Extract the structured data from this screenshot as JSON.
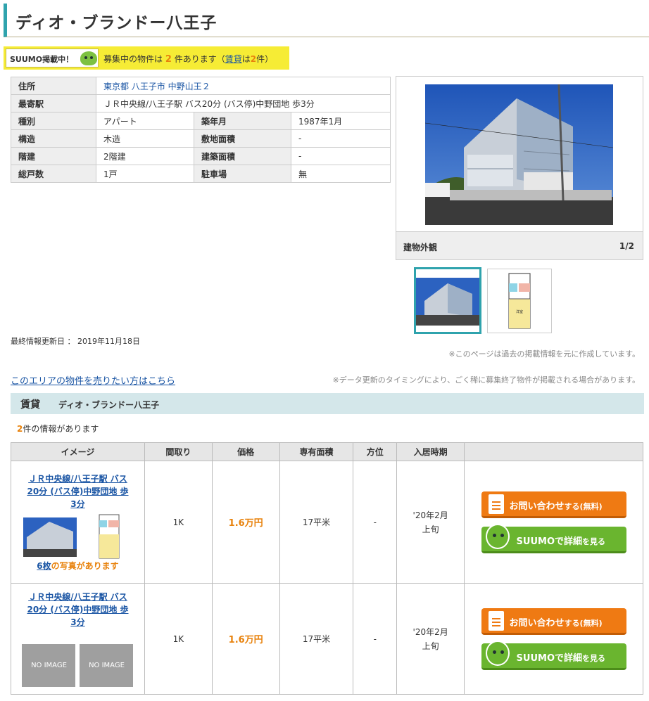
{
  "page": {
    "title": "ディオ・ブランドー八王子"
  },
  "suumo": {
    "tag": "SUUMO掲載中！",
    "msg_prefix": "募集中の物件は",
    "count": "2",
    "msg_mid": "件あります（",
    "rent_link": "賃貸",
    "msg_wa": "は",
    "rent_count": "2",
    "msg_suffix": "件）"
  },
  "info": {
    "address_label": "住所",
    "address_value": "東京都 八王子市 中野山王２",
    "station_label": "最寄駅",
    "station_value": "ＪＲ中央線/八王子駅 バス20分 (バス停)中野団地 歩3分",
    "type_label": "種別",
    "type_value": "アパート",
    "built_label": "築年月",
    "built_value": "1987年1月",
    "structure_label": "構造",
    "structure_value": "木造",
    "site_area_label": "敷地面積",
    "site_area_value": "-",
    "floors_label": "階建",
    "floors_value": "2階建",
    "building_area_label": "建築面積",
    "building_area_value": "-",
    "units_label": "総戸数",
    "units_value": "1戸",
    "parking_label": "駐車場",
    "parking_value": "無"
  },
  "gallery": {
    "caption": "建物外観",
    "pager": "1/2"
  },
  "updated": "最終情報更新日 ： 2019年11月18日",
  "note_past": "※このページは過去の掲載情報を元に作成しています。",
  "sell_link": "このエリアの物件を売りたい方はこちら",
  "note_timing": "※データ更新のタイミングにより、ごく稀に募集終了物件が掲載される場合があります。",
  "rent_section": {
    "label": "賃貸",
    "name": "ディオ・ブランドー八王子",
    "count": "2",
    "count_suffix": "件の情報があります"
  },
  "table": {
    "headers": [
      "イメージ",
      "間取り",
      "価格",
      "専有面積",
      "方位",
      "入居時期"
    ],
    "rows": [
      {
        "station": "ＪＲ中央線/八王子駅 バス20分 (バス停)中野団地 歩3分",
        "layout": "1K",
        "price": "1.6万円",
        "area": "17平米",
        "direction": "-",
        "move_in_1": "'20年2月",
        "move_in_2": "上旬",
        "photos_num": "6枚",
        "photos_text": "の写真があります"
      },
      {
        "station": "ＪＲ中央線/八王子駅 バス20分 (バス停)中野団地 歩3分",
        "layout": "1K",
        "price": "1.6万円",
        "area": "17平米",
        "direction": "-",
        "move_in_1": "'20年2月",
        "move_in_2": "上旬",
        "noimage": "NO IMAGE"
      }
    ],
    "btn_inquiry_main": "お問い合わせ",
    "btn_inquiry_sub": "する(無料)",
    "btn_suumo_main": "SUUMOで詳細",
    "btn_suumo_sub": "を見る"
  },
  "colors": {
    "accent": "#2fa3ad",
    "highlight": "#f6ec35",
    "price": "#e8820c",
    "link": "#1a55a4",
    "inquiry_button": "#ef7a13",
    "suumo_button": "#6ab52f"
  }
}
